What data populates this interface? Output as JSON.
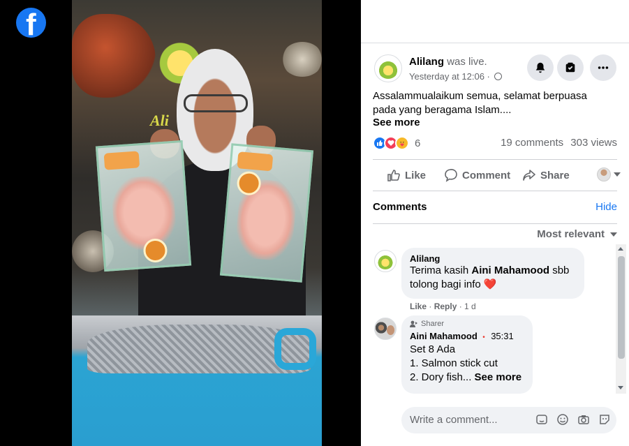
{
  "video": {
    "poster_text": "Ali"
  },
  "post": {
    "author": "Alilang",
    "status": "was live.",
    "timestamp": "Yesterday at 12:06 ·",
    "caption": "Assalammualaikum semua, selamat berpuasa pada yang beragama Islam....",
    "see_more": "See more",
    "reaction_count": "6",
    "comments_count": "19 comments",
    "views_count": "303 views",
    "buttons": {
      "notify_icon": "bell-icon",
      "save_icon": "save-icon",
      "more_icon": "more-icon"
    }
  },
  "actions": {
    "like": "Like",
    "comment": "Comment",
    "share": "Share"
  },
  "comments_section": {
    "heading": "Comments",
    "hide": "Hide",
    "sort": "Most relevant",
    "items": [
      {
        "author": "Alilang",
        "text_before": "Terima kasih ",
        "mention": "Aini Mahamood",
        "text_after": " sbb tolong bagi info",
        "emoji": "❤️",
        "like": "Like",
        "reply": "Reply",
        "age": "1 d"
      },
      {
        "badge": "Sharer",
        "author": "Aini Mahamood",
        "time": "35:31",
        "line1": "Set 8 Ada",
        "line2": "1. Salmon stick cut",
        "line3": "2. Dory fish...",
        "see_more": "See more"
      }
    ],
    "write_placeholder": "Write a comment..."
  },
  "colors": {
    "facebook_blue": "#1877f2",
    "secondary_text": "#65676b",
    "bubble_bg": "#f0f2f5"
  }
}
